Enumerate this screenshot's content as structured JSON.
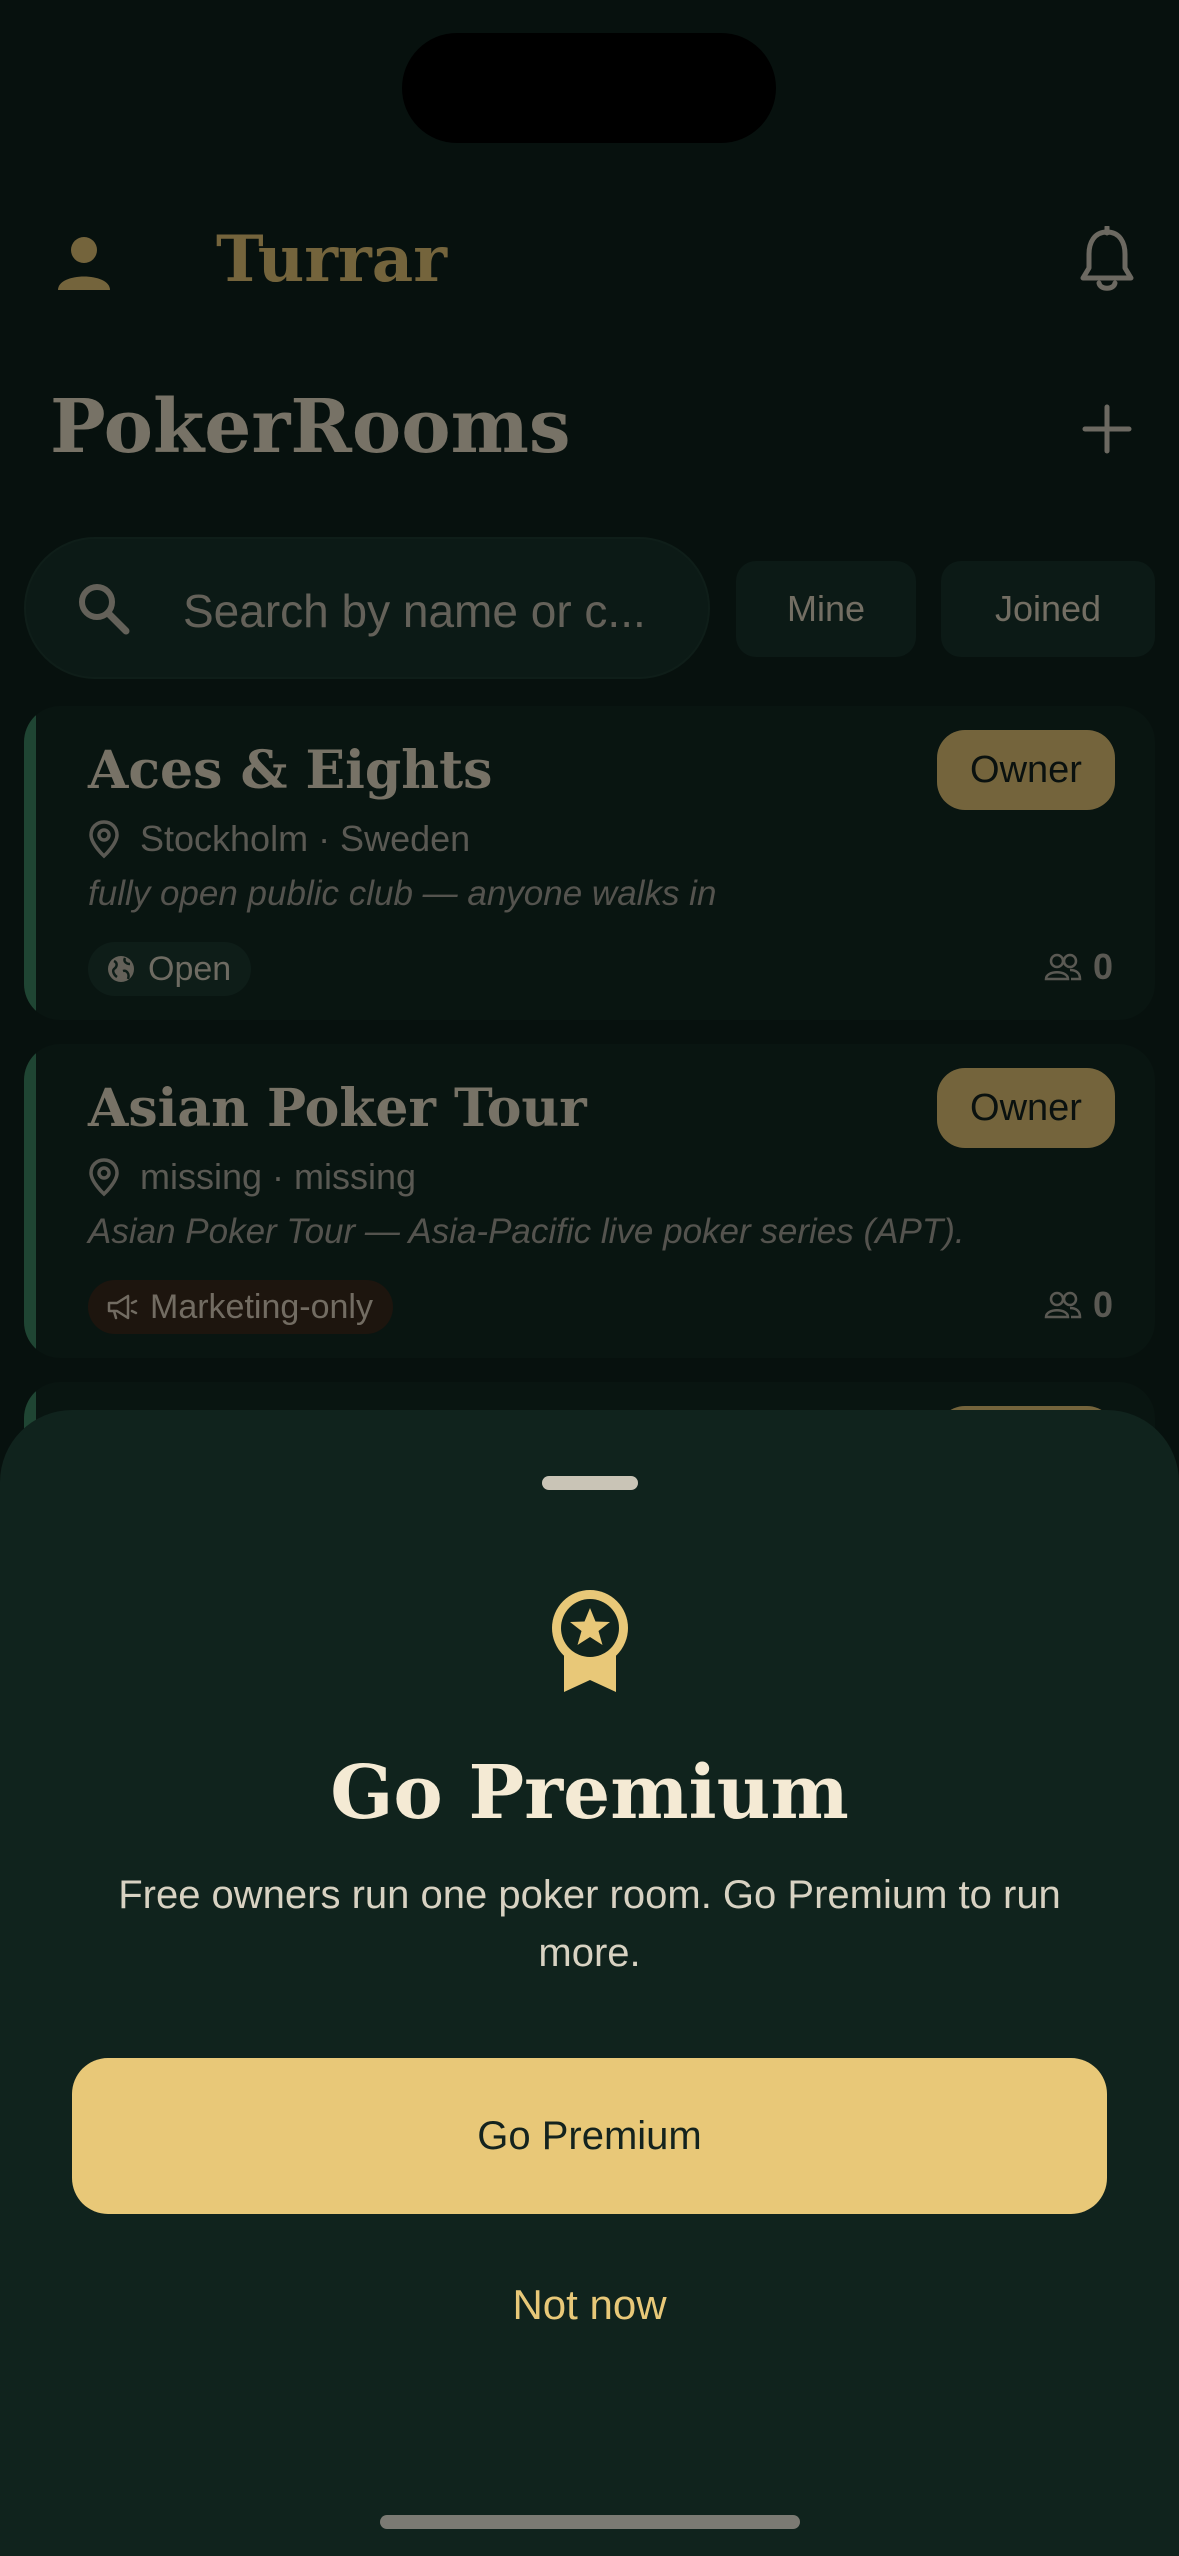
{
  "app": {
    "title": "Turrar"
  },
  "header": {
    "profile_icon": "person-icon",
    "notifications_icon": "bell-icon"
  },
  "page": {
    "title": "PokerRooms",
    "add_icon": "plus-icon"
  },
  "search": {
    "placeholder": "Search by name or c..."
  },
  "filters": [
    {
      "label": "Mine"
    },
    {
      "label": "Joined"
    }
  ],
  "rooms": [
    {
      "name": "Aces & Eights",
      "badge": "Owner",
      "location": "Stockholm · Sweden",
      "description": "fully open public club — anyone walks in",
      "tag": "Open",
      "tag_icon": "globe-icon",
      "members": "0"
    },
    {
      "name": "Asian Poker Tour",
      "badge": "Owner",
      "location": "missing · missing",
      "description": "Asian Poker Tour — Asia-Pacific live poker series (APT).",
      "tag": "Marketing-only",
      "tag_icon": "megaphone-icon",
      "members": "0"
    }
  ],
  "sheet": {
    "icon": "award-ribbon-icon",
    "title": "Go Premium",
    "body": "Free owners run one poker room. Go Premium to run more.",
    "primary_button": "Go Premium",
    "secondary_button": "Not now"
  },
  "colors": {
    "accent": "#e8c878",
    "background": "#0e221c",
    "sheet": "#10231d",
    "card_stripe": "#3f8a66"
  }
}
